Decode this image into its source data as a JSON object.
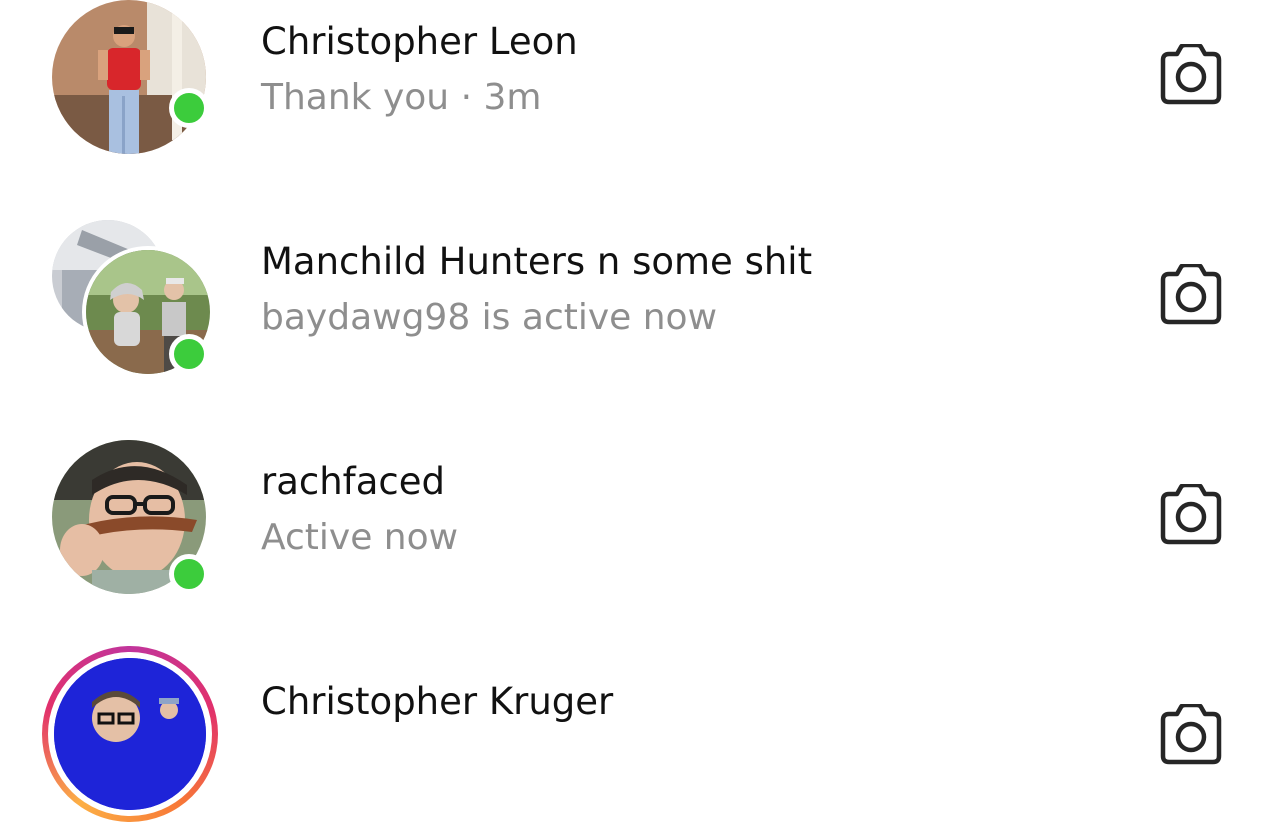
{
  "conversations": [
    {
      "name": "Christopher Leon",
      "subtitle": "Thank you · 3m",
      "online": true,
      "avatar_icon": "person-avatar-red-shirt"
    },
    {
      "name": "Manchild Hunters n some shit",
      "subtitle": "baydawg98 is active now",
      "online": true,
      "avatar_icon": "group-avatar"
    },
    {
      "name": "rachfaced",
      "subtitle": "Active now",
      "online": true,
      "avatar_icon": "person-avatar-glasses"
    },
    {
      "name": "Christopher Kruger",
      "subtitle": "",
      "online": false,
      "has_story": true,
      "avatar_icon": "person-avatar-blue-background"
    }
  ],
  "icons": {
    "camera": "camera-icon"
  },
  "colors": {
    "online_dot": "#3ccc3c",
    "name_text": "#111111",
    "subtitle_text": "#8e8e8e",
    "background": "#ffffff"
  }
}
